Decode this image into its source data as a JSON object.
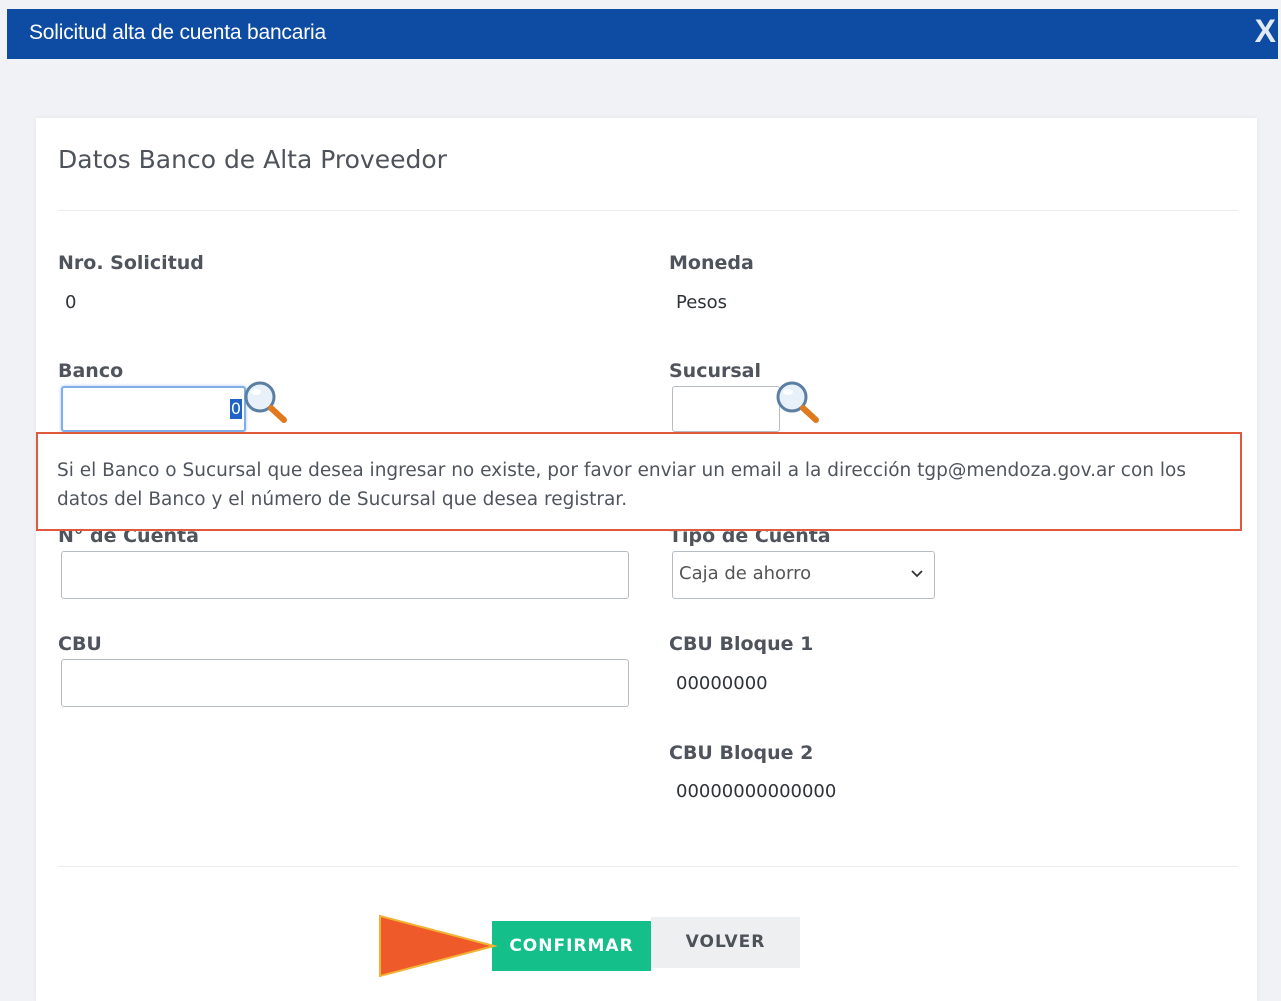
{
  "window": {
    "title": "Solicitud alta de cuenta bancaria",
    "close_label": "X"
  },
  "form": {
    "heading": "Datos Banco de Alta Proveedor",
    "nro_solicitud": {
      "label": "Nro. Solicitud",
      "value": "0"
    },
    "moneda": {
      "label": "Moneda",
      "value": "Pesos"
    },
    "banco": {
      "label": "Banco",
      "value": "",
      "selected_text": "0"
    },
    "sucursal": {
      "label": "Sucursal",
      "value": ""
    },
    "notice": "Si el Banco o Sucursal que desea ingresar no existe, por favor enviar un email a la dirección tgp@mendoza.gov.ar con los datos del Banco y el número de Sucursal que desea registrar.",
    "nro_cuenta": {
      "label": "N° de Cuenta",
      "value": ""
    },
    "tipo_cuenta": {
      "label": "Tipo de Cuenta",
      "selected": "Caja de ahorro"
    },
    "cbu": {
      "label": "CBU",
      "value": ""
    },
    "cbu_bloque1": {
      "label": "CBU Bloque 1",
      "value": "00000000"
    },
    "cbu_bloque2": {
      "label": "CBU Bloque 2",
      "value": "00000000000000"
    }
  },
  "actions": {
    "confirm_label": "CONFIRMAR",
    "back_label": "VOLVER"
  },
  "colors": {
    "titlebar": "#0e4ba3",
    "confirm": "#14bf8a",
    "notice_border": "#e0593c",
    "arrow": "#ef5a2a"
  },
  "icons": {
    "search": "magnifier-icon",
    "dropdown": "chevron-down-icon",
    "pointer": "arrow-pointer-icon"
  }
}
